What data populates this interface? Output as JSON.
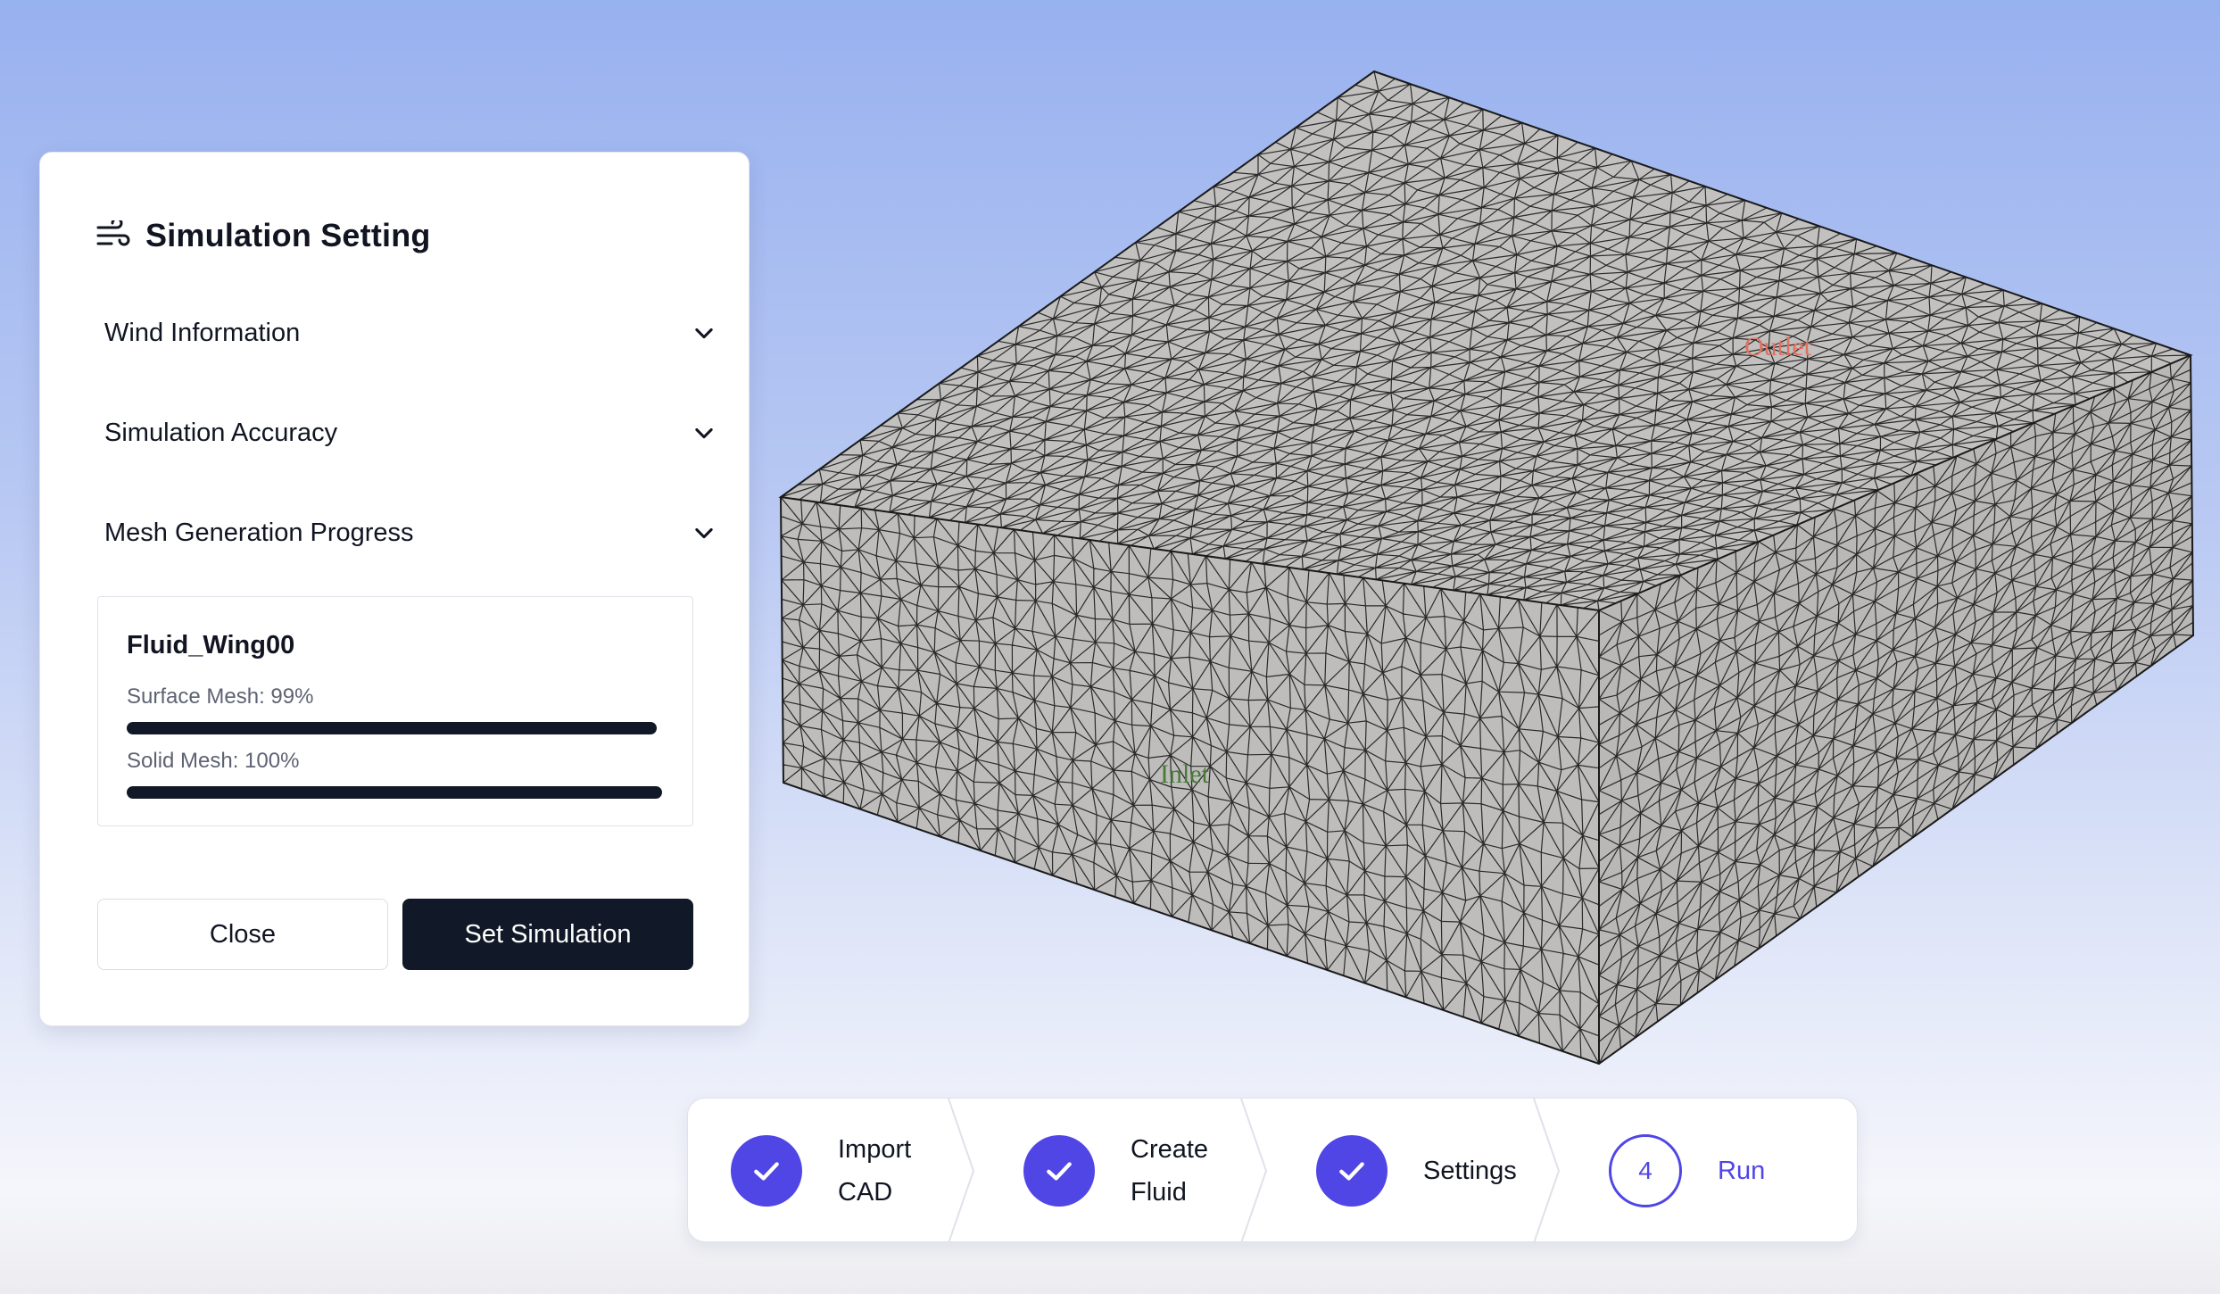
{
  "panel": {
    "title": "Simulation Setting",
    "title_icon": "wind-icon",
    "sections": [
      {
        "label": "Wind Information"
      },
      {
        "label": "Simulation Accuracy"
      },
      {
        "label": "Mesh Generation Progress"
      }
    ],
    "progress": {
      "name": "Fluid_Wing00",
      "surface_label": "Surface Mesh: 99%",
      "surface_value": 0.99,
      "solid_label": "Solid Mesh: 100%",
      "solid_value": 1.0
    },
    "close_label": "Close",
    "set_label": "Set Simulation"
  },
  "viewport": {
    "inlet_label": "Inlet",
    "outlet_label": "Outlet",
    "inlet_color": "#4a7a3a",
    "outlet_color": "#e07060",
    "mesh_fill": "#c2c1c0"
  },
  "stepper": {
    "steps": [
      {
        "line1": "Import",
        "line2": "CAD",
        "status": "done"
      },
      {
        "line1": "Create",
        "line2": "Fluid",
        "status": "done"
      },
      {
        "line1": "Settings",
        "line2": "",
        "status": "done"
      },
      {
        "number": "4",
        "line1": "Run",
        "line2": "",
        "status": "current"
      }
    ],
    "accent": "#4f46e5"
  }
}
